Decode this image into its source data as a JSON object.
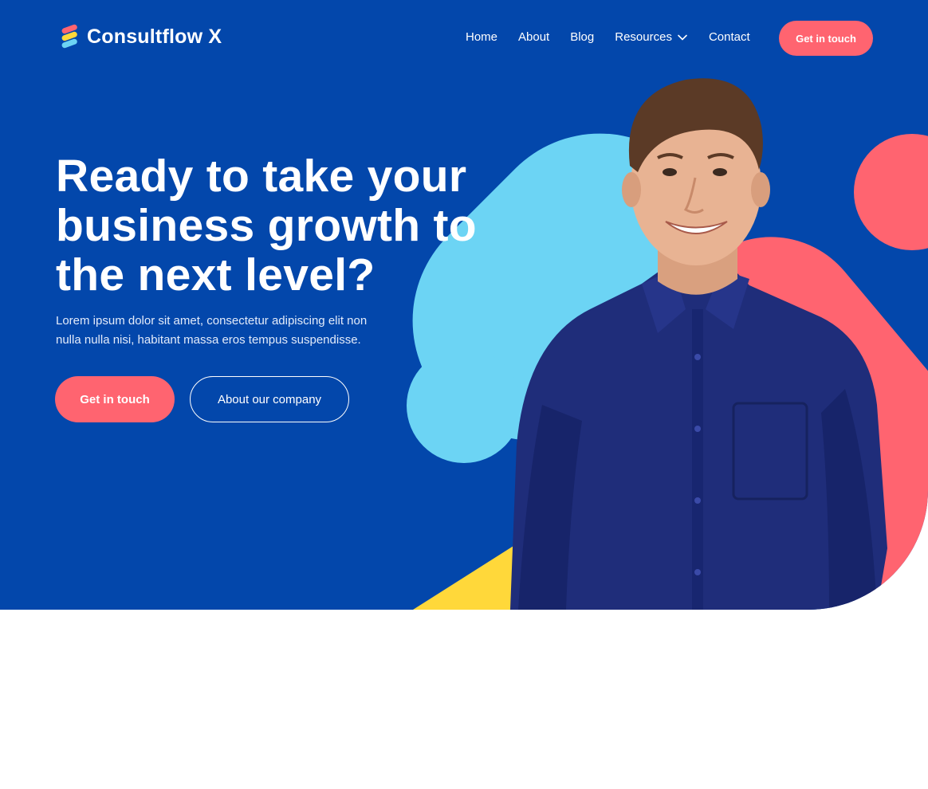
{
  "brand": {
    "name": "Consultflow X",
    "logo_icon": "stacked-stripes-logo"
  },
  "nav": {
    "items": [
      {
        "label": "Home"
      },
      {
        "label": "About"
      },
      {
        "label": "Blog"
      },
      {
        "label": "Resources",
        "icon": "chevron-down-icon"
      },
      {
        "label": "Contact"
      }
    ],
    "cta_label": "Get in touch"
  },
  "hero": {
    "headline_lines": [
      "Ready to take your",
      "business growth to",
      "the next level?"
    ],
    "subtext_lines": [
      "Lorem ipsum dolor sit amet, consectetur adipiscing elit non",
      "nulla nulla nisi, habitant massa eros tempus suspendisse."
    ],
    "primary_button": "Get in touch",
    "secondary_button": "About our company"
  },
  "colors": {
    "background_blue": "#0347ab",
    "accent_coral": "#ff6470",
    "accent_cyan": "#6cd4f4",
    "accent_yellow": "#ffd83a",
    "shirt_navy": "#1f2d7a"
  }
}
